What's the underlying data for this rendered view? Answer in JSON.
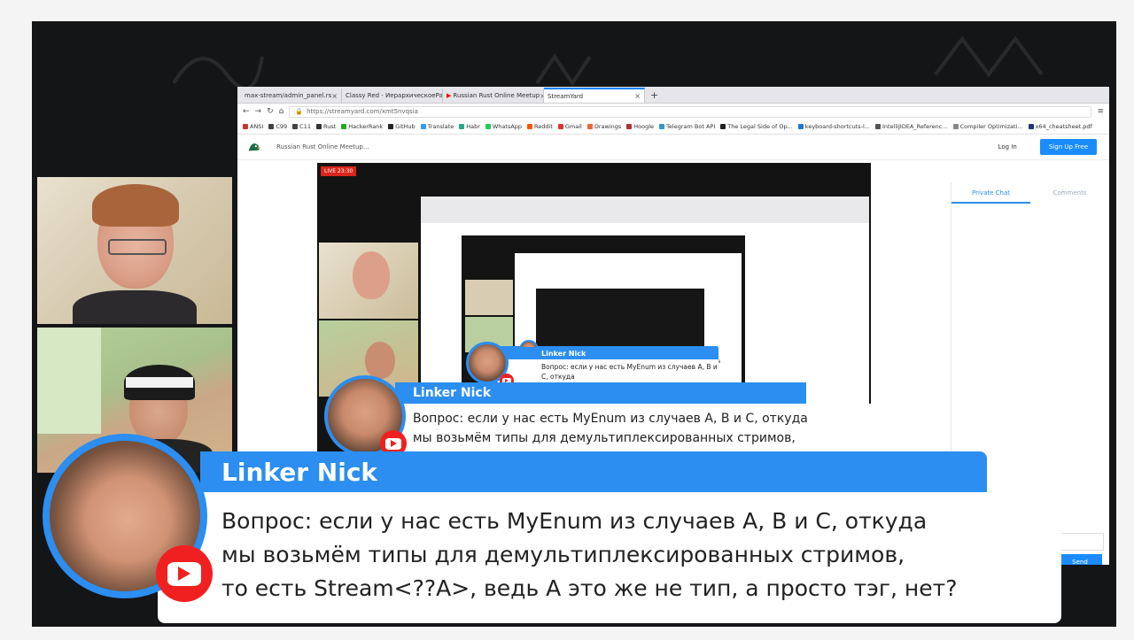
{
  "browser": {
    "tabs": [
      {
        "title": "max-stream/admin_panel.rs"
      },
      {
        "title": "Classy Red - ИерархическоеРа"
      },
      {
        "title": "Russian Rust Online Meetup"
      },
      {
        "title": "StreamYard",
        "active": true
      }
    ],
    "url": "https://streamyard.com/xmt5nvqsia",
    "bookmarks": [
      "ANSI",
      "C99",
      "C11",
      "Rust",
      "HackerRank",
      "GitHub",
      "Translate",
      "Habr",
      "WhatsApp",
      "Reddit",
      "Gmail",
      "Drawings",
      "Hoogle",
      "Telegram Bot API",
      "The Legal Side of Op...",
      "keyboard-shortcuts-l...",
      "IntelliJIDEA_Referenc...",
      "Compiler Optimizati...",
      "x64_cheatsheet.pdf"
    ]
  },
  "streamyard": {
    "event_title": "Russian Rust Online Meetup...",
    "login_label": "Log In",
    "signup_label": "Sign Up Free",
    "live_badge": "LIVE 23:30",
    "side_tabs": {
      "private_chat": "Private Chat",
      "comments": "Comments"
    },
    "send_label": "Send"
  },
  "comment": {
    "author": "Linker Nick",
    "text_line1": "Вопрос: если у нас есть MyEnum из случаев A, B и C, откуда",
    "text_line2": "мы возьмём типы для демультиплексированных стримов,",
    "text_line3": "то есть Stream<??A>, ведь A это же не тип, а просто тэг, нет?",
    "platform_icon": "youtube-icon"
  },
  "colors": {
    "banner_blue": "#2b8ef0",
    "youtube_red": "#f02020",
    "live_red": "#d9261c",
    "signup_blue": "#1a8cff"
  }
}
